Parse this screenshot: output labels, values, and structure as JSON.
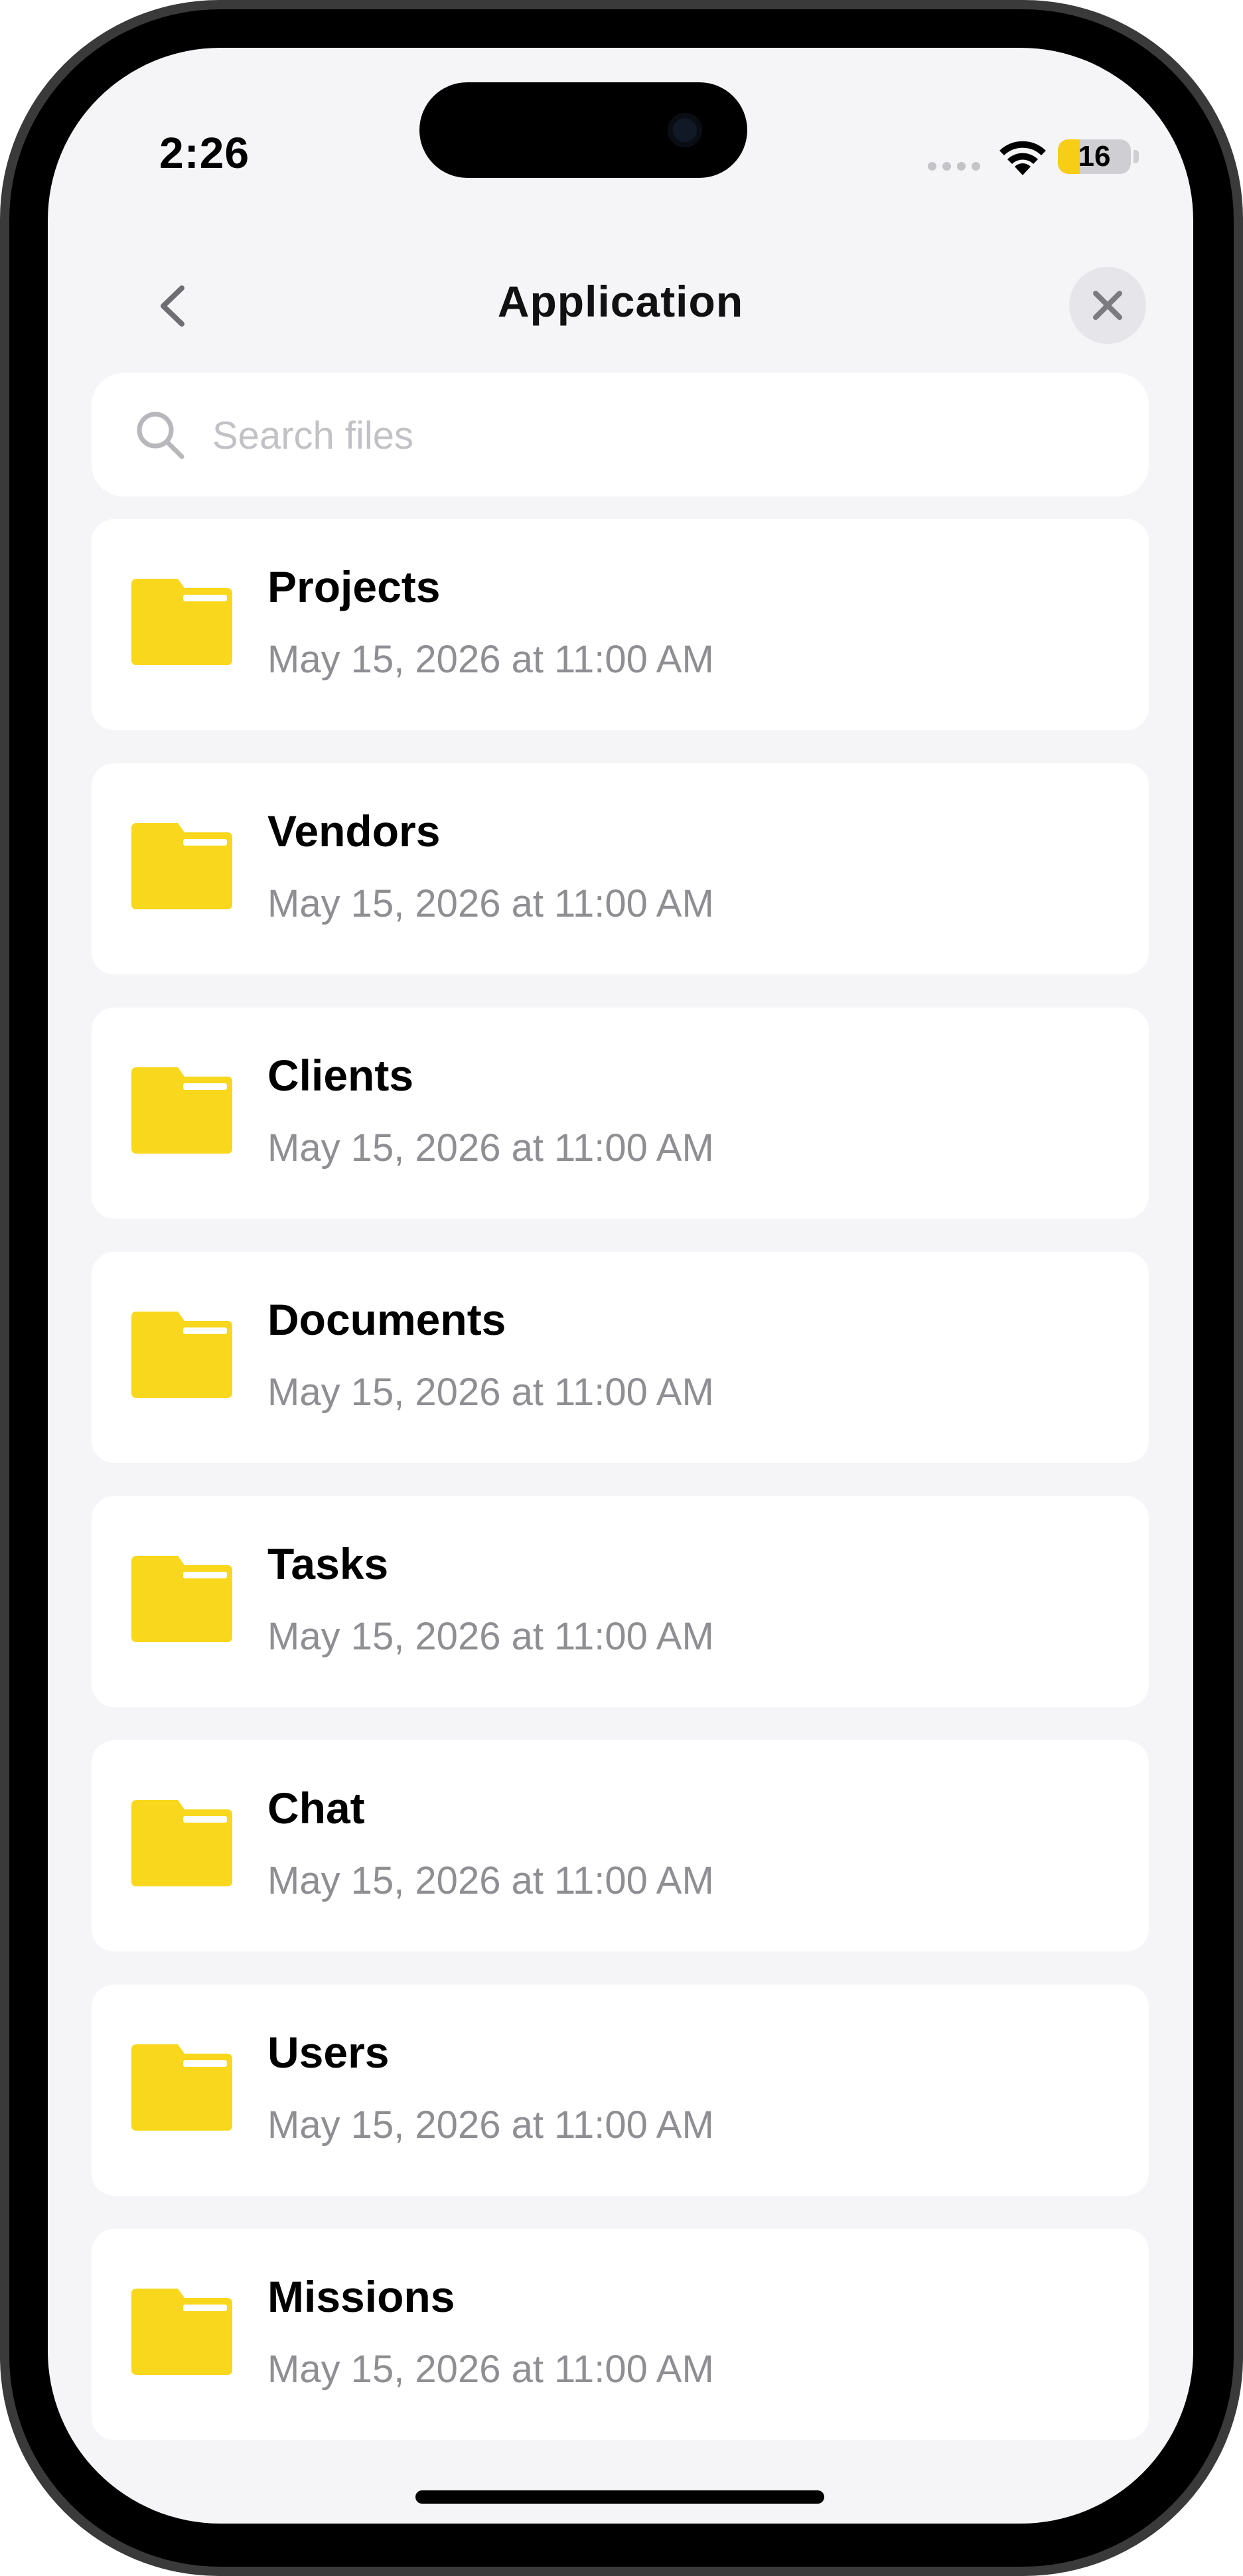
{
  "status_bar": {
    "time": "2:26",
    "battery_level": "16",
    "battery_fraction": 0.16
  },
  "header": {
    "title": "Application",
    "back_icon": "chevron-left-icon",
    "close_icon": "close-icon"
  },
  "search": {
    "placeholder": "Search files",
    "value": "",
    "icon": "search-icon"
  },
  "folders": [
    {
      "name": "Projects",
      "modified": "May 15, 2026 at 11:00 AM"
    },
    {
      "name": "Vendors",
      "modified": "May 15, 2026 at 11:00 AM"
    },
    {
      "name": "Clients",
      "modified": "May 15, 2026 at 11:00 AM"
    },
    {
      "name": "Documents",
      "modified": "May 15, 2026 at 11:00 AM"
    },
    {
      "name": "Tasks",
      "modified": "May 15, 2026 at 11:00 AM"
    },
    {
      "name": "Chat",
      "modified": "May 15, 2026 at 11:00 AM"
    },
    {
      "name": "Users",
      "modified": "May 15, 2026 at 11:00 AM"
    },
    {
      "name": "Missions",
      "modified": "May 15, 2026 at 11:00 AM"
    }
  ],
  "colors": {
    "folder": "#f9d71c",
    "folder_tab_highlight": "#ffffff",
    "background": "#f5f5f7",
    "card": "#ffffff",
    "subtitle": "#8e8e93",
    "battery_fill": "#f7cd15"
  }
}
